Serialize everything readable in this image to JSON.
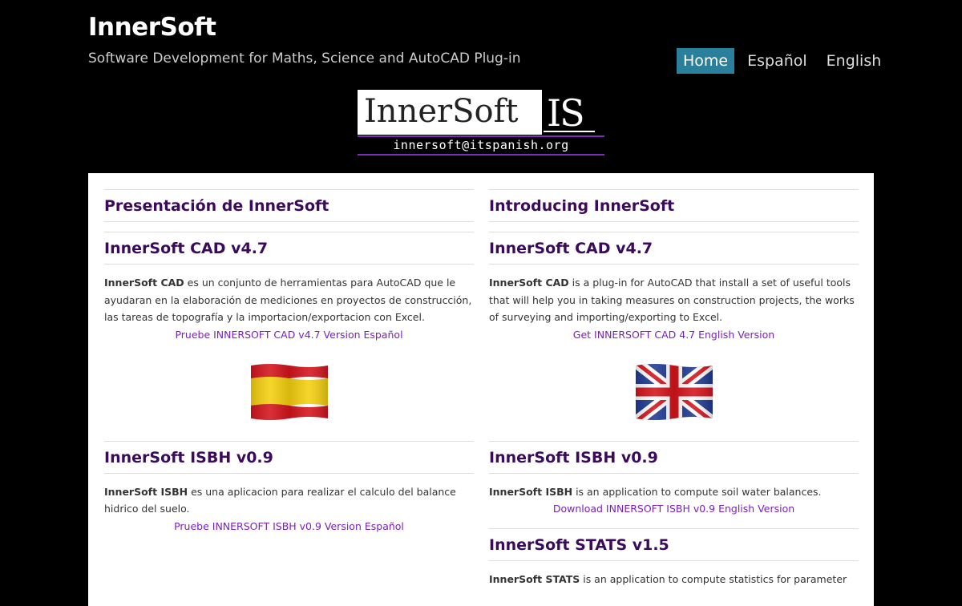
{
  "header": {
    "title": "InnerSoft",
    "tagline": "Software Development for Maths, Science and AutoCAD Plug-in"
  },
  "nav": {
    "items": [
      {
        "label": "Home",
        "active": true
      },
      {
        "label": "Español",
        "active": false
      },
      {
        "label": "English",
        "active": false
      }
    ]
  },
  "logo": {
    "text": "InnerSoft",
    "mark": "IS",
    "email": "innersoft@itspanish.org"
  },
  "left": {
    "heading": "Presentación de InnerSoft",
    "cad": {
      "title": "InnerSoft CAD v4.7",
      "bold": "InnerSoft CAD",
      "text": " es un conjunto de herramientas para AutoCAD que le ayudaran en la elaboración de mediciones en proyectos de construcción, las tareas de topografía y la importacion/exportacion con Excel.",
      "link": "Pruebe INNERSOFT CAD v4.7 Version Español"
    },
    "isbh": {
      "title": "InnerSoft ISBH v0.9",
      "bold": "InnerSoft ISBH",
      "text": " es una aplicacion para realizar el calculo del balance hidrico del suelo.",
      "link": "Pruebe INNERSOFT ISBH v0.9 Version Español"
    }
  },
  "right": {
    "heading": "Introducing InnerSoft",
    "cad": {
      "title": "InnerSoft CAD v4.7",
      "bold": "InnerSoft CAD",
      "text": " is a plug-in for AutoCAD that install a set of useful tools that will help you in taking measures on construction projects, the works of surveying and importing/exporting to Excel.",
      "link": "Get INNERSOFT CAD 4.7 English Version"
    },
    "isbh": {
      "title": "InnerSoft ISBH v0.9",
      "bold": "InnerSoft ISBH",
      "text": " is an application to compute soil water balances.",
      "link": "Download INNERSOFT ISBH v0.9 English Version"
    },
    "stats": {
      "title": "InnerSoft STATS v1.5",
      "bold": "InnerSoft STATS",
      "text": " is an application to compute statistics for parameter"
    }
  },
  "colors": {
    "background": "#000000",
    "nav_active": "#2a7f9a",
    "heading": "#3b0a5a",
    "link": "#7a1fc0",
    "logo_accent": "#7a2fbf"
  }
}
